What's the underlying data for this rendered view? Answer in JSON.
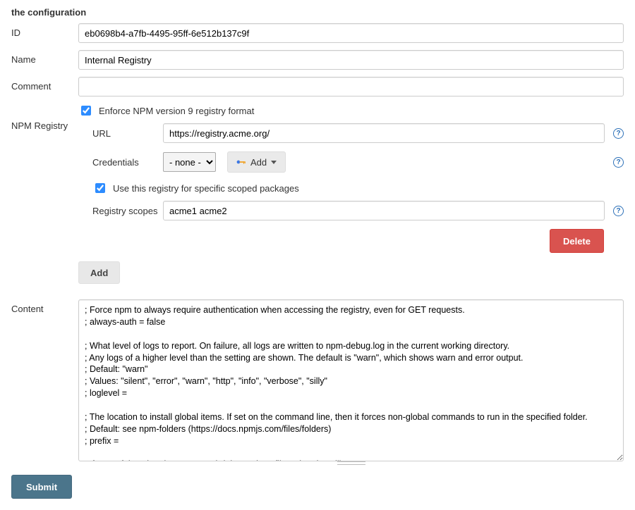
{
  "section_title": "the configuration",
  "labels": {
    "id": "ID",
    "name": "Name",
    "comment": "Comment",
    "npm_registry": "NPM Registry",
    "content": "Content"
  },
  "fields": {
    "id": "eb0698b4-a7fb-4495-95ff-6e512b137c9f",
    "name": "Internal Registry",
    "comment": ""
  },
  "registry": {
    "enforce_label": "Enforce NPM version 9 registry format",
    "enforce_checked": true,
    "url_label": "URL",
    "url_value": "https://registry.acme.org/",
    "credentials_label": "Credentials",
    "credentials_selected": "- none -",
    "add_button": "Add",
    "scoped_label": "Use this registry for specific scoped packages",
    "scoped_checked": true,
    "scopes_label": "Registry scopes",
    "scopes_value": "acme1 acme2",
    "delete_button": "Delete",
    "registry_add_button": "Add"
  },
  "content": "; Force npm to always require authentication when accessing the registry, even for GET requests.\n; always-auth = false\n\n; What level of logs to report. On failure, all logs are written to npm-debug.log in the current working directory.\n; Any logs of a higher level than the setting are shown. The default is \"warn\", which shows warn and error output.\n; Default: \"warn\"\n; Values: \"silent\", \"error\", \"warn\", \"http\", \"info\", \"verbose\", \"silly\"\n; loglevel =\n\n; The location to install global items. If set on the command line, then it forces non-global commands to run in the specified folder.\n; Default: see npm-folders (https://docs.npmjs.com/files/folders)\n; prefix =\n\n; If set to false, then ignore npm-shrinkwrap.json files when installing.\n; Default: true\n; shrinkwrap =",
  "submit_button": "Submit"
}
